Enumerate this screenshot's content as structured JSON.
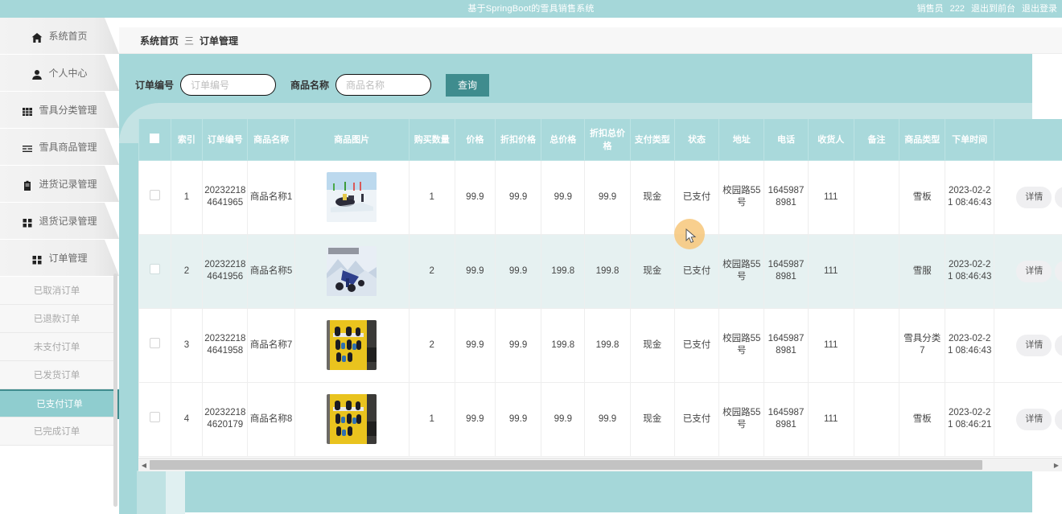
{
  "topbar": {
    "title": "基于SpringBoot的雪具销售系统",
    "role_label": "销售员",
    "user_name": "222",
    "exit_front": "退出到前台",
    "logout": "退出登录"
  },
  "sidebar": {
    "items": [
      {
        "label": "系统首页",
        "icon": "home-icon"
      },
      {
        "label": "个人中心",
        "icon": "user-icon"
      },
      {
        "label": "雪具分类管理",
        "icon": "grid-icon"
      },
      {
        "label": "雪具商品管理",
        "icon": "list-icon"
      },
      {
        "label": "进货记录管理",
        "icon": "clipboard-icon"
      },
      {
        "label": "退货记录管理",
        "icon": "squares-icon"
      },
      {
        "label": "订单管理",
        "icon": "squares-icon"
      }
    ],
    "subitems": [
      {
        "label": "已取消订单",
        "active": false
      },
      {
        "label": "已退款订单",
        "active": false
      },
      {
        "label": "未支付订单",
        "active": false
      },
      {
        "label": "已发货订单",
        "active": false
      },
      {
        "label": "已支付订单",
        "active": true
      },
      {
        "label": "已完成订单",
        "active": false
      }
    ]
  },
  "breadcrumb": {
    "root": "系统首页",
    "separator": "三",
    "current": "订单管理"
  },
  "search": {
    "order_no_label": "订单编号",
    "order_no_placeholder": "订单编号",
    "order_no_value": "",
    "product_name_label": "商品名称",
    "product_name_placeholder": "商品名称",
    "product_name_value": "",
    "query_button": "查询"
  },
  "table": {
    "columns": [
      "",
      "索引",
      "订单编号",
      "商品名称",
      "商品图片",
      "购买数量",
      "价格",
      "折扣价格",
      "总价格",
      "折扣总价格",
      "支付类型",
      "状态",
      "地址",
      "电话",
      "收货人",
      "备注",
      "商品类型",
      "下单时间",
      ""
    ],
    "rows": [
      {
        "index": "1",
        "order_no": "202322184641965",
        "product_name": "商品名称1",
        "image": "snow-scene",
        "quantity": "1",
        "price": "99.9",
        "discount_price": "99.9",
        "total_price": "99.9",
        "discount_total_price": "99.9",
        "pay_type": "现金",
        "status": "已支付",
        "address": "校园路55号",
        "phone": "16459878981",
        "receiver": "111",
        "remark": "",
        "product_type": "雪板",
        "order_time": "2023-02-21 08:46:43",
        "detail_button": "详情"
      },
      {
        "index": "2",
        "order_no": "202322184641956",
        "product_name": "商品名称5",
        "image": "mountain-sled",
        "quantity": "2",
        "price": "99.9",
        "discount_price": "99.9",
        "total_price": "199.8",
        "discount_total_price": "199.8",
        "pay_type": "现金",
        "status": "已支付",
        "address": "校园路55号",
        "phone": "16459878981",
        "receiver": "111",
        "remark": "",
        "product_type": "雪服",
        "order_time": "2023-02-21 08:46:43",
        "detail_button": "详情"
      },
      {
        "index": "3",
        "order_no": "202322184641958",
        "product_name": "商品名称7",
        "image": "yellow-rack",
        "quantity": "2",
        "price": "99.9",
        "discount_price": "99.9",
        "total_price": "199.8",
        "discount_total_price": "199.8",
        "pay_type": "现金",
        "status": "已支付",
        "address": "校园路55号",
        "phone": "16459878981",
        "receiver": "111",
        "remark": "",
        "product_type": "雪具分类7",
        "order_time": "2023-02-21 08:46:43",
        "detail_button": "详情"
      },
      {
        "index": "4",
        "order_no": "202322184620179",
        "product_name": "商品名称8",
        "image": "yellow-rack",
        "quantity": "1",
        "price": "99.9",
        "discount_price": "99.9",
        "total_price": "99.9",
        "discount_total_price": "99.9",
        "pay_type": "现金",
        "status": "已支付",
        "address": "校园路55号",
        "phone": "16459878981",
        "receiver": "111",
        "remark": "",
        "product_type": "雪板",
        "order_time": "2023-02-21 08:46:21",
        "detail_button": "详情"
      }
    ]
  },
  "colors": {
    "brand_teal": "#a5d7d9",
    "accent_dark_teal": "#3f8c8e",
    "header_row": "#a9d9db",
    "alt_row": "#e6f1f1"
  }
}
